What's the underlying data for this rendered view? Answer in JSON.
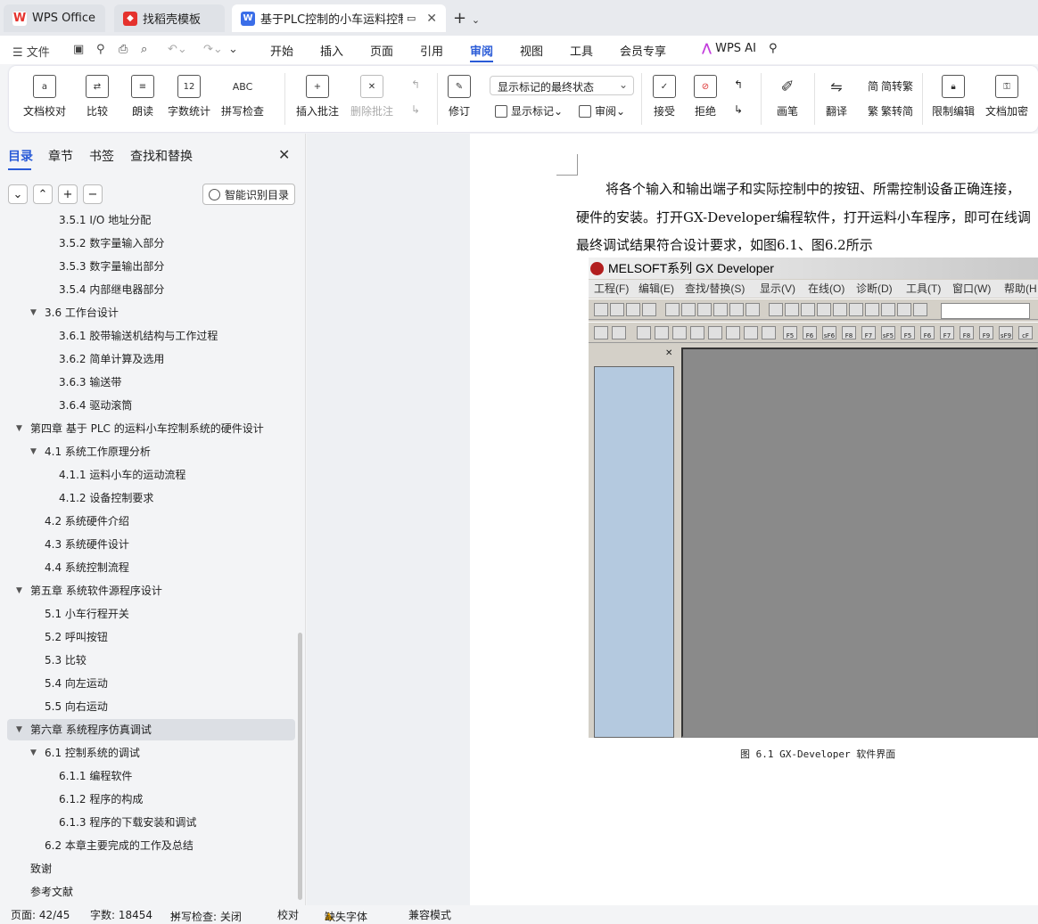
{
  "tabs": {
    "wps": "WPS Office",
    "templates": "找稻壳模板",
    "document": "基于PLC控制的小车运料控制系"
  },
  "menu": {
    "file": "文件",
    "items": [
      "开始",
      "插入",
      "页面",
      "引用",
      "审阅",
      "视图",
      "工具",
      "会员专享"
    ],
    "active": "审阅",
    "ai": "WPS AI"
  },
  "ribbon": {
    "proofread": "文档校对",
    "compare": "比较",
    "read_aloud": "朗读",
    "word_count": "字数统计",
    "word_count_icon": "12",
    "spell_check": "拼写检查",
    "spell_icon": "ABC",
    "insert_comment": "插入批注",
    "delete_comment": "删除批注",
    "revise": "修订",
    "markup_select": "显示标记的最终状态",
    "show_markup": "显示标记",
    "review": "审阅",
    "accept": "接受",
    "reject": "拒绝",
    "pen": "画笔",
    "translate": "翻译",
    "to_traditional": "简转繁",
    "to_simplified": "繁转简",
    "restrict_edit": "限制编辑",
    "encrypt": "文档加密"
  },
  "nav": {
    "tabs": [
      "目录",
      "章节",
      "书签",
      "查找和替换"
    ],
    "smart_toc": "智能识别目录",
    "toc": [
      {
        "text": "3.5.1 I/O 地址分配",
        "level": 3,
        "expanded": null
      },
      {
        "text": "3.5.2  数字量输入部分",
        "level": 3,
        "expanded": null
      },
      {
        "text": "3.5.3  数字量输出部分",
        "level": 3,
        "expanded": null
      },
      {
        "text": "3.5.4  内部继电器部分",
        "level": 3,
        "expanded": null
      },
      {
        "text": "3.6  工作台设计",
        "level": 2,
        "expanded": true
      },
      {
        "text": "3.6.1 胶带输送机结构与工作过程",
        "level": 3,
        "expanded": null
      },
      {
        "text": "3.6.2 简单计算及选用",
        "level": 3,
        "expanded": null
      },
      {
        "text": "3.6.3  输送带",
        "level": 3,
        "expanded": null
      },
      {
        "text": "3.6.4 驱动滚筒",
        "level": 3,
        "expanded": null
      },
      {
        "text": "第四章  基于 PLC 的运料小车控制系统的硬件设计",
        "level": 1,
        "expanded": true
      },
      {
        "text": "4.1  系统工作原理分析",
        "level": 2,
        "expanded": true
      },
      {
        "text": "4.1.1  运料小车的运动流程",
        "level": 3,
        "expanded": null
      },
      {
        "text": "4.1.2 设备控制要求",
        "level": 3,
        "expanded": null
      },
      {
        "text": "4.2  系统硬件介绍",
        "level": 2,
        "expanded": null
      },
      {
        "text": "4.3  系统硬件设计",
        "level": 2,
        "expanded": null
      },
      {
        "text": "4.4  系统控制流程",
        "level": 2,
        "expanded": null
      },
      {
        "text": "第五章  系统软件源程序设计",
        "level": 1,
        "expanded": true
      },
      {
        "text": "5.1  小车行程开关",
        "level": 2,
        "expanded": null
      },
      {
        "text": "5.2  呼叫按钮",
        "level": 2,
        "expanded": null
      },
      {
        "text": "5.3  比较",
        "level": 2,
        "expanded": null
      },
      {
        "text": "5.4  向左运动",
        "level": 2,
        "expanded": null
      },
      {
        "text": "5.5  向右运动",
        "level": 2,
        "expanded": null
      },
      {
        "text": "第六章  系统程序仿真调试",
        "level": 1,
        "expanded": true,
        "selected": true
      },
      {
        "text": "6.1  控制系统的调试",
        "level": 2,
        "expanded": true
      },
      {
        "text": "6.1.1 编程软件",
        "level": 3,
        "expanded": null
      },
      {
        "text": "6.1.2  程序的构成",
        "level": 3,
        "expanded": null
      },
      {
        "text": "6.1.3  程序的下载安装和调试",
        "level": 3,
        "expanded": null
      },
      {
        "text": "6.2  本章主要完成的工作及总结",
        "level": 2,
        "expanded": null
      },
      {
        "text": "致谢",
        "level": 1,
        "expanded": null
      },
      {
        "text": "参考文献",
        "level": 1,
        "expanded": null
      }
    ]
  },
  "document": {
    "lines": [
      "将各个输入和输出端子和实际控制中的按钮、所需控制设备正确连接，",
      "硬件的安装。打开GX-Developer编程软件，打开运料小车程序，即可在线调",
      "最终调试结果符合设计要求，如图6.1、图6.2所示"
    ],
    "figure": {
      "window_title": "MELSOFT系列 GX Developer",
      "menu": [
        "工程(F)",
        "编辑(E)",
        "查找/替换(S)",
        "显示(V)",
        "在线(O)",
        "诊断(D)",
        "工具(T)",
        "窗口(W)",
        "帮助(H"
      ],
      "fkeys": [
        "F5",
        "F6",
        "sF6",
        "F8",
        "F7",
        "sF5",
        "F5",
        "F6",
        "F7",
        "F8",
        "F9",
        "sF9",
        "cF"
      ]
    },
    "caption": "图 6.1 GX-Developer 软件界面"
  },
  "status": {
    "page": "页面: 42/45",
    "words": "字数: 18454",
    "spell": "拼写检查: 关闭",
    "proof": "校对",
    "missing_font": "缺失字体",
    "compat": "兼容模式"
  }
}
